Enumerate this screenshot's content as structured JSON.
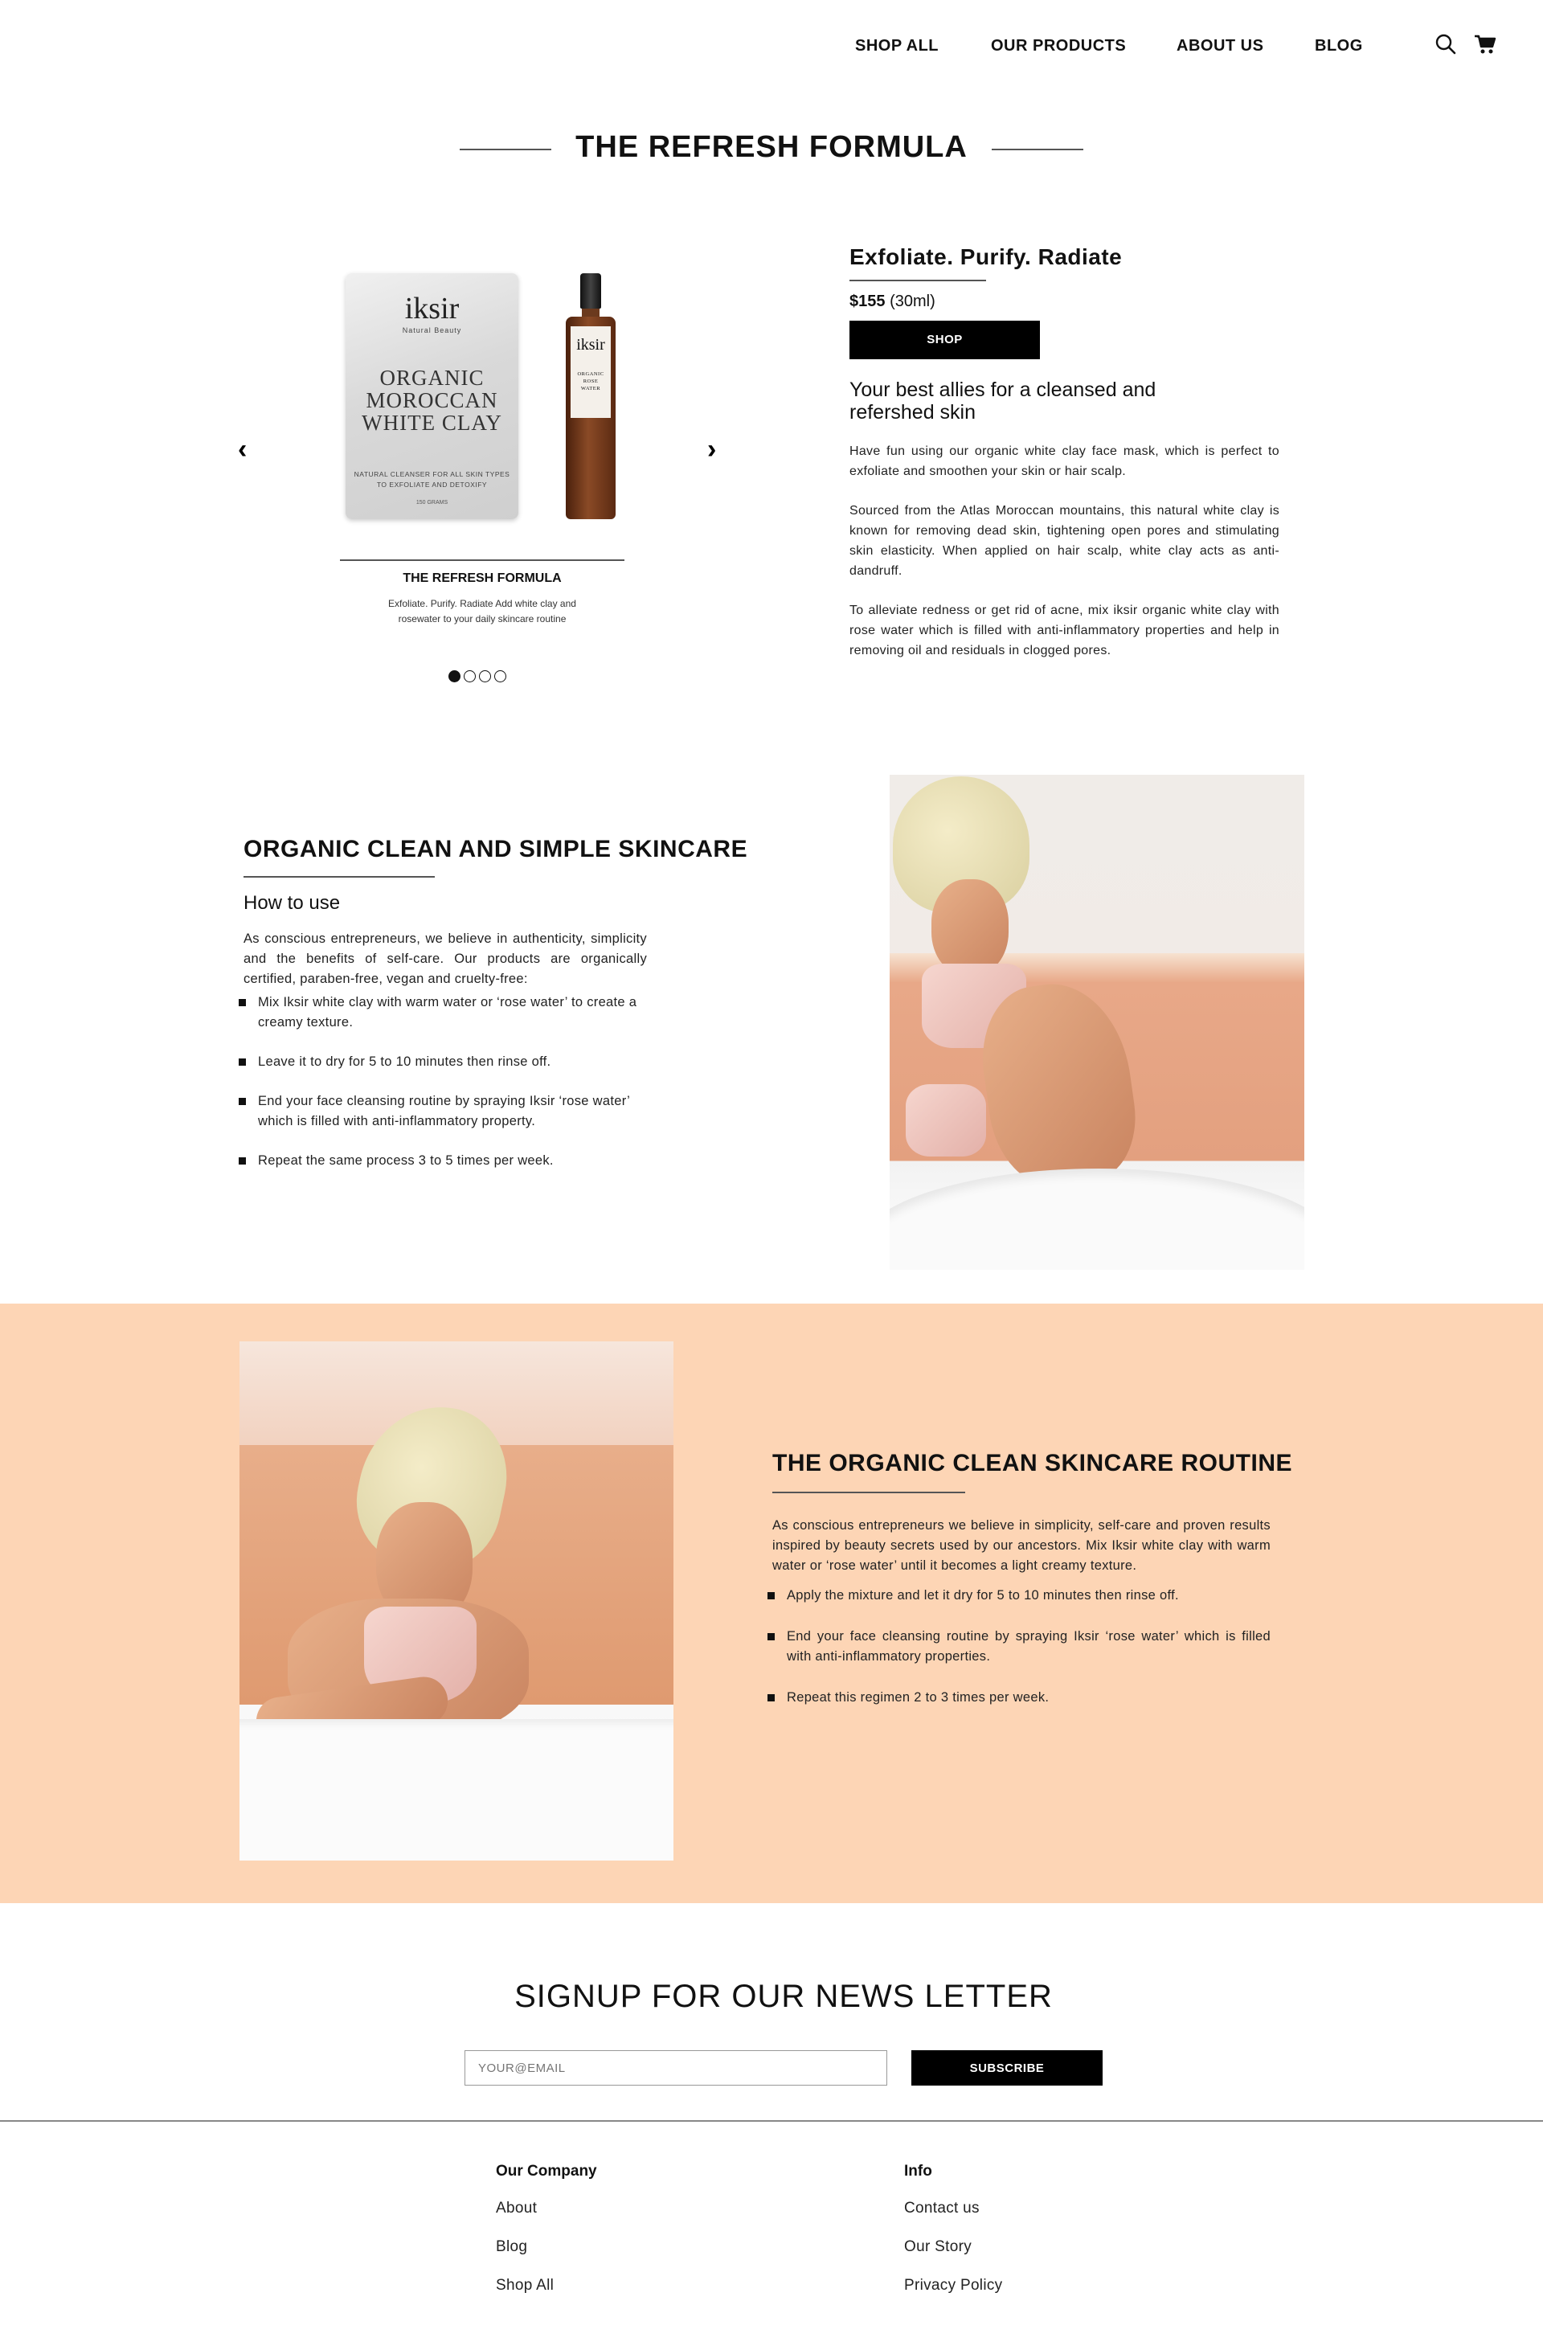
{
  "nav": {
    "links": [
      "SHOP ALL",
      "OUR PRODUCTS",
      "ABOUT US",
      "BLOG"
    ],
    "icons": [
      "search-icon",
      "cart-icon"
    ]
  },
  "section_title": "THE REFRESH FORMULA",
  "carousel": {
    "pouch": {
      "brand": "iksir",
      "sub": "Natural Beauty",
      "line1": "ORGANIC",
      "line2": "MOROCCAN",
      "line3": "WHITE CLAY",
      "small1": "NATURAL CLEANSER FOR ALL SKIN TYPES",
      "small2": "TO EXFOLIATE AND DETOXIFY",
      "grams": "150 GRAMS"
    },
    "bottle": {
      "brand": "iksir",
      "line1": "ORGANIC ROSE",
      "line2": "WATER"
    },
    "caption_title": "THE REFRESH FORMULA",
    "caption_text": "Exfoliate. Purify. Radiate Add white clay and rosewater to your daily skincare routine",
    "prev": "‹",
    "next": "›",
    "dots_total": 4,
    "dot_active": 1
  },
  "product": {
    "title": "Exfoliate. Purify. Radiate",
    "price": "$155",
    "size": "(30ml)",
    "shop_label": "SHOP",
    "subtitle": "Your best allies for a cleansed and refershed skin",
    "p1": "Have fun using our organic white clay face mask, which is perfect to exfoliate and smoothen your skin or hair scalp.",
    "p2": "Sourced from the Atlas Moroccan mountains, this natural white clay is known for removing dead skin, tightening open pores and stimulating skin elasticity. When applied on hair scalp, white clay acts as anti-dandruff.",
    "p3": "To alleviate redness or get rid of acne, mix iksir organic white clay with rose water which is filled with anti-inflammatory properties and help in removing oil and residuals in clogged pores."
  },
  "organic": {
    "title": "ORGANIC CLEAN AND SIMPLE SKINCARE",
    "subtitle": "How to use",
    "intro": "As conscious entrepreneurs, we believe in authenticity, simplicity and the benefits of self-care. Our products are organically certified, paraben-free, vegan and cruelty-free:",
    "steps": [
      "Mix Iksir white clay with warm water or ‘rose water’ to create a creamy texture.",
      "Leave it to dry for 5 to 10 minutes then rinse off.",
      "End your face cleansing routine by spraying Iksir ‘rose water’ which is filled with anti-inflammatory property.",
      "Repeat the same process 3 to 5 times per week."
    ]
  },
  "routine": {
    "title": "THE ORGANIC CLEAN SKINCARE ROUTINE",
    "intro": "As conscious entrepreneurs we believe in simplicity, self-care and proven results inspired by beauty secrets used by our ancestors. Mix Iksir white clay with warm water or ‘rose water’ until it becomes a light creamy texture.",
    "steps": [
      "Apply the mixture and let it dry for 5 to 10 minutes then rinse off.",
      "End your face cleansing routine by spraying Iksir ‘rose water’ which is filled with anti-inflammatory properties.",
      "Repeat this regimen 2 to 3 times per week."
    ]
  },
  "newsletter": {
    "title": "SIGNUP FOR OUR NEWS LETTER",
    "placeholder": "YOUR@EMAIL",
    "button": "SUBSCRIBE"
  },
  "footer": {
    "col1": {
      "title": "Our Company",
      "links": [
        "About",
        "Blog",
        "Shop All"
      ]
    },
    "col2": {
      "title": "Info",
      "links": [
        "Contact us",
        "Our Story",
        "Privacy Policy"
      ]
    }
  },
  "colors": {
    "peach": "#fdd5b5",
    "black": "#000000"
  }
}
